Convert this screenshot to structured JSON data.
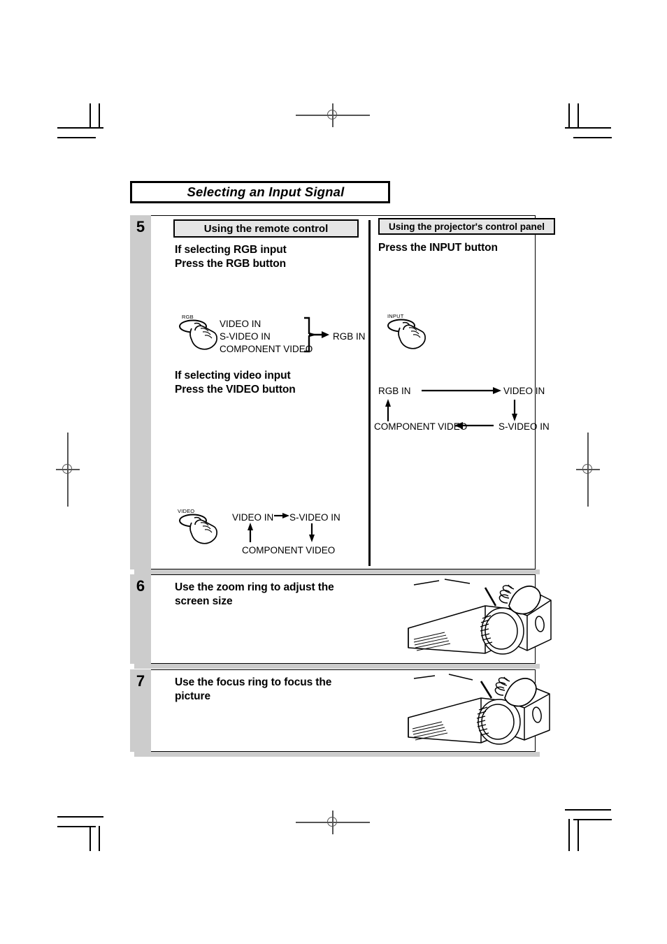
{
  "page": {
    "title": "Selecting an Input Signal"
  },
  "steps": [
    {
      "number": "5",
      "left_panel": {
        "label": "Using the remote control",
        "rgb_section": {
          "heading_line1": "If selecting RGB input",
          "heading_line2": "Press the RGB button",
          "button_caption": "RGB",
          "sources": [
            "VIDEO IN",
            "S-VIDEO IN",
            "COMPONENT VIDEO"
          ],
          "target": "RGB IN"
        },
        "video_section": {
          "heading_line1": "If selecting video input",
          "heading_line2": "Press the VIDEO button",
          "button_caption": "VIDEO",
          "cycle": [
            "VIDEO IN",
            "S-VIDEO IN",
            "COMPONENT VIDEO"
          ]
        }
      },
      "right_panel": {
        "label": "Using the projector's control panel",
        "heading": "Press the INPUT button",
        "button_caption": "INPUT",
        "cycle": [
          "RGB IN",
          "VIDEO IN",
          "S-VIDEO IN",
          "COMPONENT VIDEO"
        ]
      }
    },
    {
      "number": "6",
      "heading_line1": "Use the zoom ring to adjust the",
      "heading_line2": "screen size",
      "illustration": "projector-zoom-ring-hand"
    },
    {
      "number": "7",
      "heading_line1": "Use the focus ring to focus the",
      "heading_line2": "picture",
      "illustration": "projector-focus-ring-hand"
    }
  ],
  "colors": {
    "gray_bar": "#cccccc",
    "label_fill": "#e6e6e6",
    "ink": "#000000"
  }
}
